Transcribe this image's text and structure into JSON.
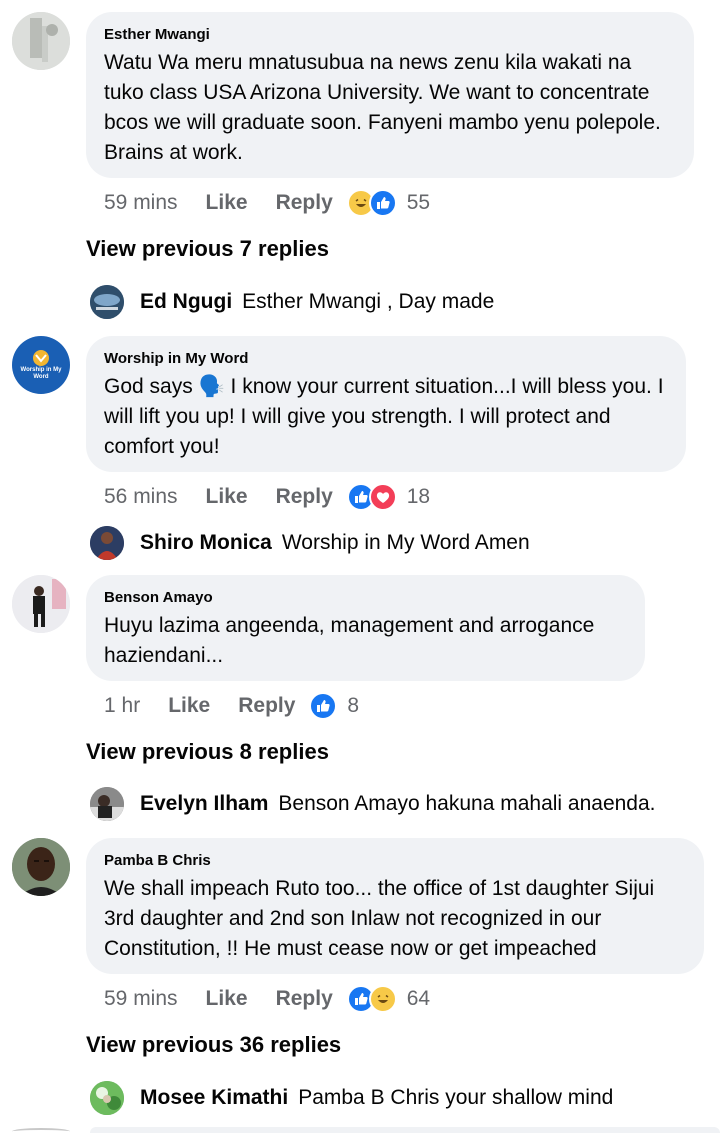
{
  "comments": [
    {
      "author": "Esther Mwangi",
      "text": "Watu Wa meru mnatusubua na news zenu kila wakati na tuko class USA Arizona University. We want to concentrate bcos we will graduate soon. Fanyeni mambo yenu polepole. Brains at work.",
      "time": "59 mins",
      "like_label": "Like",
      "reply_label": "Reply",
      "reactions": [
        "haha",
        "like"
      ],
      "reaction_count": "55",
      "view_previous": "View previous 7 replies",
      "reply": {
        "author": "Ed Ngugi",
        "text": "Esther Mwangi , Day made"
      }
    },
    {
      "author": "Worship in My Word",
      "avatar_text": "Worship in My Word",
      "text": "God says 🗣️ I know your current situation...I will bless you. I will lift you up! I will give you strength. I will protect and comfort you!",
      "time": "56 mins",
      "like_label": "Like",
      "reply_label": "Reply",
      "reactions": [
        "like",
        "love"
      ],
      "reaction_count": "18",
      "reply": {
        "author": "Shiro Monica",
        "text": "Worship in My Word Amen"
      }
    },
    {
      "author": "Benson Amayo",
      "text": "Huyu lazima angeenda, management and arrogance haziendani...",
      "time": "1 hr",
      "like_label": "Like",
      "reply_label": "Reply",
      "reactions": [
        "like"
      ],
      "reaction_count": "8",
      "view_previous": "View previous 8 replies",
      "reply": {
        "author": "Evelyn Ilham",
        "text": "Benson Amayo hakuna mahali anaenda."
      }
    },
    {
      "author": "Pamba B Chris",
      "text": "We shall impeach Ruto too... the office of 1st daughter Sijui 3rd daughter and 2nd son Inlaw not recognized in our Constitution, !! He must cease now or get impeached",
      "time": "59 mins",
      "like_label": "Like",
      "reply_label": "Reply",
      "reactions": [
        "like",
        "haha"
      ],
      "reaction_count": "64",
      "view_previous": "View previous 36 replies",
      "reply": {
        "author": "Mosee Kimathi",
        "text": "Pamba B Chris your shallow mind"
      }
    }
  ],
  "colors": {
    "bubble": "#f0f2f5",
    "meta_text": "#65676b",
    "like_blue": "#1877f2",
    "love_red": "#f33e58",
    "haha_yellow": "#f7c948"
  }
}
